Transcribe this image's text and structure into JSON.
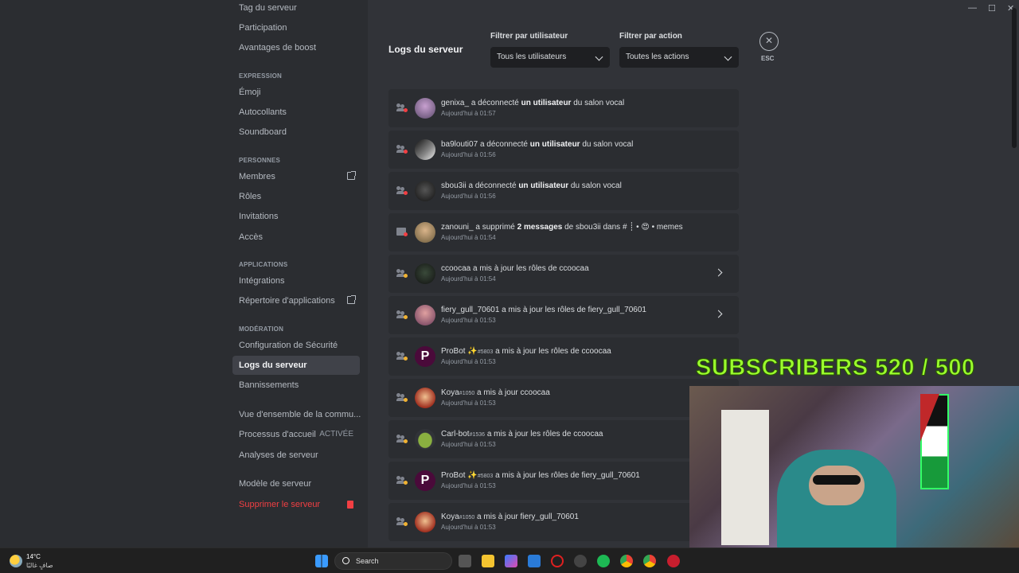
{
  "sidebar": {
    "top_items": [
      "Tag du serveur",
      "Participation",
      "Avantages de boost"
    ],
    "sections": [
      {
        "heading": "EXPRESSION",
        "items": [
          "Émoji",
          "Autocollants",
          "Soundboard"
        ]
      },
      {
        "heading": "PERSONNES",
        "items": [
          "Membres",
          "Rôles",
          "Invitations",
          "Accès"
        ]
      },
      {
        "heading": "APPLICATIONS",
        "items": [
          "Intégrations",
          "Répertoire d'applications"
        ]
      },
      {
        "heading": "MODÉRATION",
        "items": [
          "Configuration de Sécurité",
          "Logs du serveur",
          "Bannissements"
        ]
      }
    ],
    "community": [
      "Vue d'ensemble de la commu...",
      "Processus d'accueil",
      "Analyses de serveur"
    ],
    "onboarding_status": "ACTIVÉE",
    "template": "Modèle de serveur",
    "delete": "Supprimer le serveur"
  },
  "main": {
    "title": "Logs du serveur",
    "filter_user_label": "Filtrer par utilisateur",
    "filter_user_value": "Tous les utilisateurs",
    "filter_action_label": "Filtrer par action",
    "filter_action_value": "Toutes les actions",
    "esc_label": "ESC"
  },
  "logs": [
    {
      "user": "genixa_",
      "action": "a déconnecté",
      "target": "un utilisateur",
      "suffix": "du salon vocal",
      "time": "Aujourd'hui à 01:57"
    },
    {
      "user": "ba9louti07",
      "action": "a déconnecté",
      "target": "un utilisateur",
      "suffix": "du salon vocal",
      "time": "Aujourd'hui à 01:56"
    },
    {
      "user": "sbou3ii",
      "action": "a déconnecté",
      "target": "un utilisateur",
      "suffix": "du salon vocal",
      "time": "Aujourd'hui à 01:56"
    },
    {
      "user": "zanouni_",
      "action": "a supprimé",
      "target": "2 messages",
      "suffix": "de sbou3ii dans # ┊ • 😍 • memes",
      "time": "Aujourd'hui à 01:54"
    },
    {
      "user": "ccoocaa",
      "action": "a mis à jour les rôles de ccoocaa",
      "time": "Aujourd'hui à 01:54"
    },
    {
      "user": "fiery_gull_70601",
      "action": "a mis à jour les rôles de fiery_gull_70601",
      "time": "Aujourd'hui à 01:53"
    },
    {
      "user": "ProBot ✨",
      "tag": "#5803",
      "action": "a mis à jour les rôles de ccoocaa",
      "time": "Aujourd'hui à 01:53"
    },
    {
      "user": "Koya",
      "tag": "#1050",
      "action": "a mis à jour ccoocaa",
      "time": "Aujourd'hui à 01:53"
    },
    {
      "user": "Carl-bot",
      "tag": "#1536",
      "action": "a mis à jour les rôles de ccoocaa",
      "time": "Aujourd'hui à 01:53"
    },
    {
      "user": "ProBot ✨",
      "tag": "#5803",
      "action": "a mis à jour les rôles de fiery_gull_70601",
      "time": "Aujourd'hui à 01:53"
    },
    {
      "user": "Koya",
      "tag": "#1050",
      "action": "a mis à jour fiery_gull_70601",
      "time": "Aujourd'hui à 01:53"
    }
  ],
  "overlay": {
    "subscribers": "SUBSCRIBERS 520 / 500"
  },
  "taskbar": {
    "temp": "14°C",
    "weather": "صافٍ غالبًا",
    "search": "Search"
  },
  "colors": {
    "accent_text": "#9cff2e",
    "danger": "#f23f43",
    "active_bg": "#404249"
  }
}
